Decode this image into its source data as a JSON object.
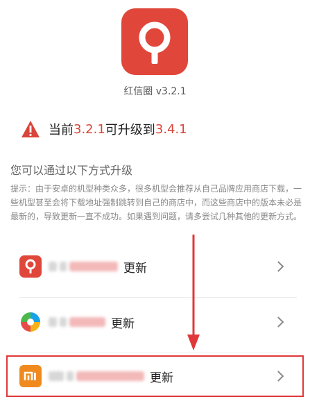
{
  "app": {
    "name_version": "红信圈 v3.2.1",
    "icon": "search-pin-icon",
    "brand_color": "#e0473a"
  },
  "update": {
    "icon": "warning-triangle-icon",
    "prefix": "当前 ",
    "current_version": "3.2.1",
    "middle": " 可升级到 ",
    "new_version": "3.4.1",
    "accent": "#d9453a"
  },
  "section_title": "您可以通过以下方式升级",
  "tip": "提示：由于安卓的机型种类众多，很多机型会推荐从自己品牌应用商店下载，一些机型甚至会将下载地址强制跳转到自己的商店中，而这些商店中的版本未必是最新的，导致更新一直不成功。如果遇到问题，请多尝试几种其他的更新方式。",
  "options": [
    {
      "label": "更新",
      "icon": "hongxinquan-app-icon",
      "color": "#e0473a"
    },
    {
      "label": "更新",
      "icon": "app-store-pinwheel-icon",
      "color": "#1aa1e6"
    },
    {
      "label": "更新",
      "icon": "mi-store-icon",
      "color": "#f08a1e"
    }
  ],
  "annotation": {
    "color": "#e0383a"
  }
}
